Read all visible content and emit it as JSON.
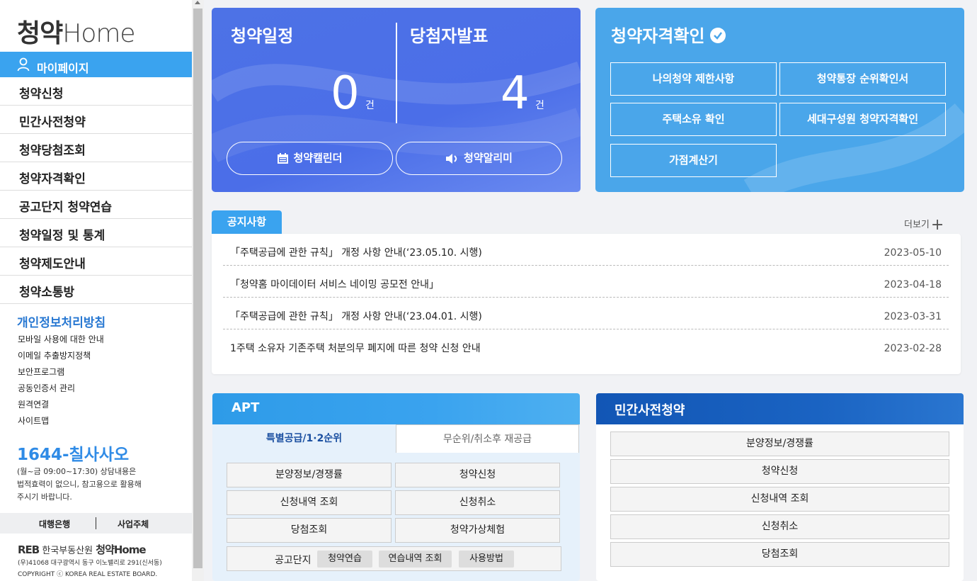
{
  "sidebar": {
    "logo_korean": "청약",
    "logo_home": "Home",
    "mypage": "마이페이지",
    "nav": [
      "청약신청",
      "민간사전청약",
      "청약당첨조회",
      "청약자격확인",
      "공고단지 청약연습",
      "청약일정 및 통계",
      "청약제도안내",
      "청약소통방"
    ],
    "privacy": "개인정보처리방침",
    "links": [
      "모바일 사용에 대한 안내",
      "이메일 추출방지정책",
      "보안프로그램",
      "공동인증서 관리",
      "원격연결",
      "사이트맵"
    ],
    "phone": "1644-칠사사오",
    "hours_line1": "(월~금 09:00~17:30) 상담내용은",
    "hours_line2": "법적효력이 없으니, 참고용으로 활용해",
    "hours_line3": "주시기 바랍니다.",
    "partner_bank": "대행은행",
    "partner_biz": "사업주체",
    "footer_org_logo": "REB",
    "footer_org": "한국부동산원",
    "footer_brand": "청약Home",
    "address": "(우)41068 대구광역시 동구 이노밸리로 291(신서동)",
    "copyright": "COPYRIGHT ⓒ KOREA REAL ESTATE BOARD."
  },
  "schedule": {
    "title": "청약일정",
    "count": "0",
    "unit": "건",
    "calendar_label": "청약캘린더"
  },
  "winner": {
    "title": "당첨자발표",
    "count": "4",
    "unit": "건",
    "alarm_label": "청약알리미"
  },
  "qualification": {
    "title": "청약자격확인",
    "buttons": [
      "나의청약 제한사항",
      "청약통장 순위확인서",
      "주택소유 확인",
      "세대구성원 청약자격확인",
      "가점계산기"
    ]
  },
  "notice": {
    "tab": "공지사항",
    "more": "더보기",
    "items": [
      {
        "title": "「주택공급에 관한 규칙」 개정 사항 안내(‘23.05.10. 시행)",
        "date": "2023-05-10"
      },
      {
        "title": "「청약홈 마이데이터 서비스 네이밍 공모전 안내」",
        "date": "2023-04-18"
      },
      {
        "title": "「주택공급에 관한 규칙」 개정 사항 안내(‘23.04.01. 시행)",
        "date": "2023-03-31"
      },
      {
        "title": "1주택 소유자 기존주택 처분의무 폐지에 따른 청약 신청 안내",
        "date": "2023-02-28"
      }
    ]
  },
  "apt": {
    "title": "APT",
    "tab_active": "특별공급/1·2순위",
    "tab_inactive": "무순위/취소후 재공급",
    "buttons": [
      "분양정보/경쟁률",
      "청약신청",
      "신청내역 조회",
      "신청취소",
      "당첨조회",
      "청약가상체험"
    ],
    "practice_label": "공고단지",
    "practice_chips": [
      "청약연습",
      "연습내역 조회",
      "사용방법"
    ]
  },
  "private": {
    "title": "민간사전청약",
    "buttons": [
      "분양정보/경쟁률",
      "청약신청",
      "신청내역 조회",
      "신청취소",
      "당첨조회"
    ]
  }
}
